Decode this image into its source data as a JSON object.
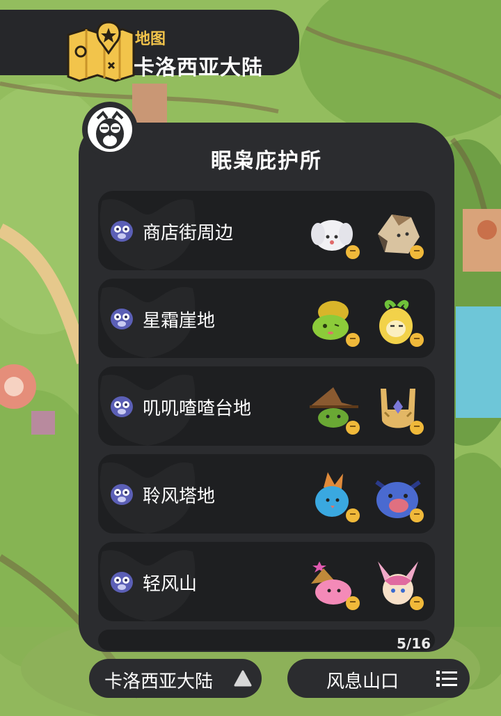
{
  "header": {
    "subtitle": "地图",
    "title": "卡洛西亚大陆",
    "icon": "folded-map-pin-icon",
    "accent": "#f2c44b"
  },
  "panel": {
    "title": "眠枭庇护所",
    "owl_icon": "owl-icon",
    "rows": [
      {
        "label": "商店街周边",
        "icon": "owl-tag-icon",
        "creatures": [
          "white-bunny-pet-icon",
          "rock-beast-pet-icon"
        ]
      },
      {
        "label": "星霜崖地",
        "icon": "owl-tag-icon",
        "creatures": [
          "green-turtle-pet-icon",
          "sprout-seed-pet-icon"
        ]
      },
      {
        "label": "叽叽喳喳台地",
        "icon": "owl-tag-icon",
        "creatures": [
          "witch-hat-frog-pet-icon",
          "crystal-golem-pet-icon"
        ]
      },
      {
        "label": "聆风塔地",
        "icon": "owl-tag-icon",
        "creatures": [
          "blue-chick-pet-icon",
          "blue-dragon-pet-icon"
        ]
      },
      {
        "label": "轻风山",
        "icon": "owl-tag-icon",
        "creatures": [
          "pink-wizard-pet-icon",
          "pink-bat-pet-icon"
        ]
      }
    ],
    "counter": "5/16"
  },
  "bottom": {
    "region_label": "卡洛西亚大陆",
    "region_icon": "triangle-up-icon",
    "location_label": "风息山口",
    "location_icon": "list-icon"
  }
}
